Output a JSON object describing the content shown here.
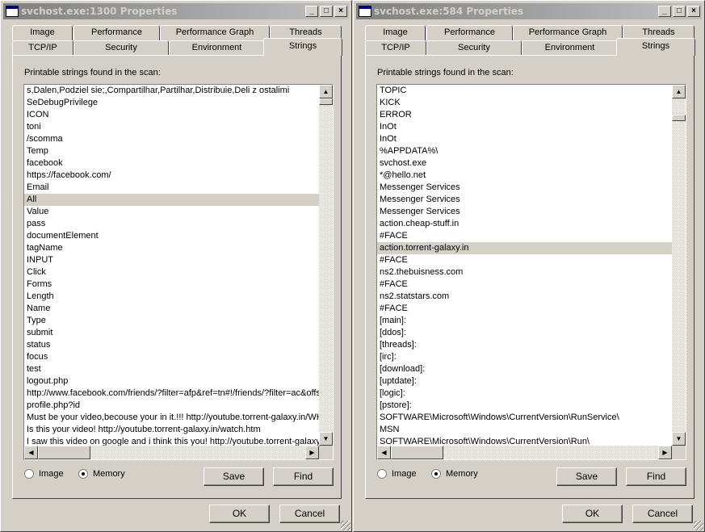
{
  "windows": [
    {
      "title": "svchost.exe:1300 Properties",
      "tabs_row1": [
        "Image",
        "Performance",
        "Performance Graph",
        "Threads"
      ],
      "tabs_row2": [
        "TCP/IP",
        "Security",
        "Environment",
        "Strings"
      ],
      "active_tab": "Strings",
      "label": "Printable strings found in the scan:",
      "selected_index": 9,
      "strings": [
        "s,Dalen,Podziel sie;,Compartilhar,Partilhar,Distribuie,Deli z ostalimi",
        "SeDebugPrivilege",
        "ICON",
        "toni",
        "/scomma",
        "Temp",
        "facebook",
        "https://facebook.com/",
        "Email",
        "All",
        "Value",
        "pass",
        "documentElement",
        "tagName",
        "INPUT",
        "Click",
        "Forms",
        "Length",
        "Name",
        "Type",
        "submit",
        "status",
        "focus",
        "test",
        "logout.php",
        "http://www.facebook.com/friends/?filter=afp&ref=tn#!/friends/?filter=ac&offset",
        "profile.php?id",
        "Must be your video,becouse your  in it.!!! http://youtube.torrent-galaxy.in/WH",
        "Is this your video! http://youtube.torrent-galaxy.in/watch.htm",
        "I saw this video on google and i think this you! http://youtube.torrent-galaxy.in"
      ],
      "radio_image": "Image",
      "radio_memory": "Memory",
      "selected_radio": "Memory",
      "save": "Save",
      "find": "Find",
      "ok": "OK",
      "cancel": "Cancel",
      "vscroll_position": 0.0
    },
    {
      "title": "svchost.exe:584 Properties",
      "tabs_row1": [
        "Image",
        "Performance",
        "Performance Graph",
        "Threads"
      ],
      "tabs_row2": [
        "TCP/IP",
        "Security",
        "Environment",
        "Strings"
      ],
      "active_tab": "Strings",
      "label": "Printable strings found in the scan:",
      "selected_index": 13,
      "strings": [
        "TOPIC",
        "KICK",
        "ERROR",
        "InOt",
        "InOt",
        "%APPDATA%\\",
        "svchost.exe",
        "*@hello.net",
        "Messenger Services",
        "Messenger Services",
        "Messenger Services",
        "action.cheap-stuff.in",
        "#FACE",
        "action.torrent-galaxy.in",
        "#FACE",
        "ns2.thebuisness.com",
        "#FACE",
        "ns2.statstars.com",
        "#FACE",
        "[main]:",
        "[ddos]:",
        "[threads]:",
        "[irc]:",
        "[download]:",
        "[uptdate]:",
        "[logic]:",
        "[pstore]:",
        "SOFTWARE\\Microsoft\\Windows\\CurrentVersion\\RunService\\",
        "MSN",
        "SOFTWARE\\Microsoft\\Windows\\CurrentVersion\\Run\\"
      ],
      "radio_image": "Image",
      "radio_memory": "Memory",
      "selected_radio": "Memory",
      "save": "Save",
      "find": "Find",
      "ok": "OK",
      "cancel": "Cancel",
      "vscroll_position": 0.05
    }
  ]
}
